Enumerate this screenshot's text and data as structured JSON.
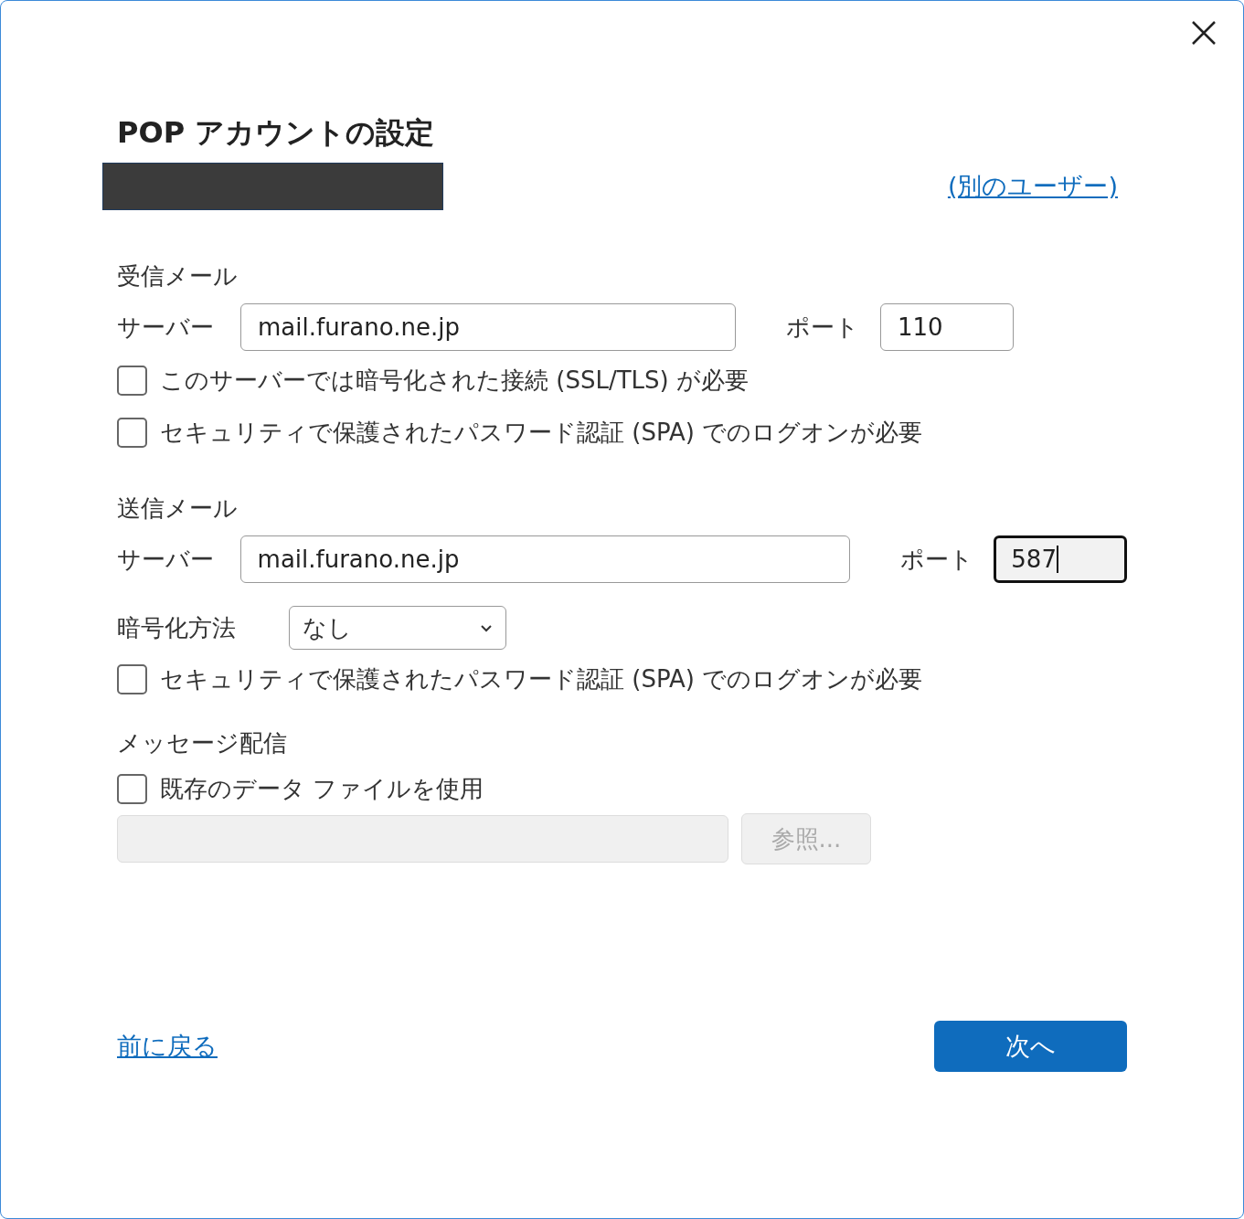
{
  "dialog": {
    "title": "POP アカウントの設定",
    "other_user_link": "(別のユーザー)"
  },
  "incoming": {
    "heading": "受信メール",
    "server_label": "サーバー",
    "server": "mail.furano.ne.jp",
    "port_label": "ポート",
    "port": "110",
    "port_focused": false,
    "options": [
      {
        "label": "このサーバーでは暗号化された接続 (SSL/TLS) が必要",
        "checked": false
      },
      {
        "label": "セキュリティで保護されたパスワード認証 (SPA) でのログオンが必要",
        "checked": false
      }
    ]
  },
  "outgoing": {
    "heading": "送信メール",
    "server_label": "サーバー",
    "server": "mail.furano.ne.jp",
    "port_label": "ポート",
    "port": "587",
    "port_focused": true,
    "encryption_label": "暗号化方法",
    "encryption": "なし",
    "options": [
      {
        "label": "セキュリティで保護されたパスワード認証 (SPA) でのログオンが必要",
        "checked": false
      }
    ]
  },
  "delivery": {
    "heading": "メッセージ配信",
    "option": {
      "label": "既存のデータ ファイルを使用",
      "checked": false
    },
    "path_field": {
      "disabled": true
    },
    "browse_button": {
      "label": "参照...",
      "disabled": true
    }
  },
  "footer": {
    "back_link": "前に戻る",
    "next_button": "次へ"
  }
}
